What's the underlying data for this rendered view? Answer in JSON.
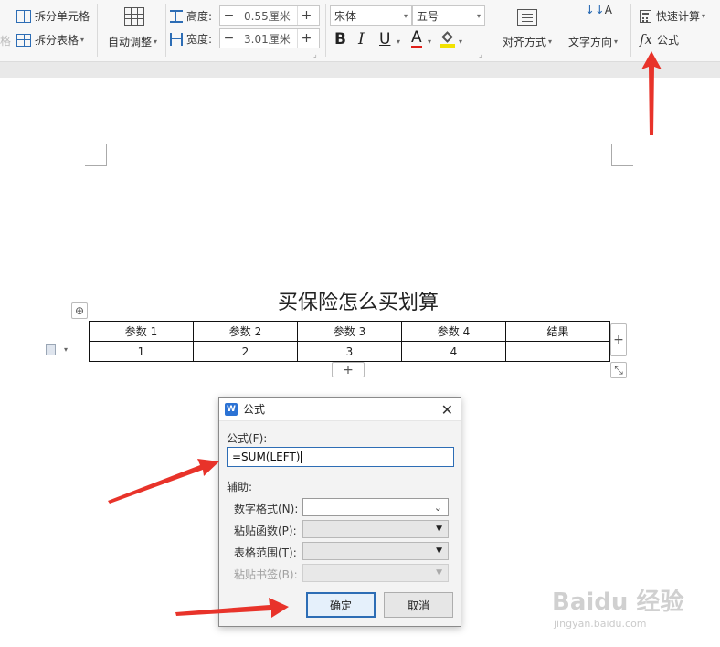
{
  "ribbon": {
    "split_cell": "拆分单元格",
    "split_table": "拆分表格",
    "auto_adjust": "自动调整",
    "height_label": "高度:",
    "height_value": "0.55厘米",
    "width_label": "宽度:",
    "width_value": "3.01厘米",
    "font_name": "宋体",
    "font_size": "五号",
    "align": "对齐方式",
    "text_direction": "文字方向",
    "quick_calc": "快速计算",
    "formula": "公式",
    "fx_glyph": "fx",
    "bold": "B",
    "italic": "I",
    "underline": "U",
    "font_color": "A",
    "minus": "−",
    "plus": "+",
    "left_fragment": "格"
  },
  "document": {
    "title": "买保险怎么买划算",
    "table": {
      "headers": [
        "参数 1",
        "参数 2",
        "参数 3",
        "参数 4",
        "结果"
      ],
      "row": [
        "1",
        "2",
        "3",
        "4",
        ""
      ]
    },
    "add_row": "+",
    "add_col": "+",
    "move_handle": "⊕"
  },
  "dialog": {
    "logo": "W",
    "title": "公式",
    "close": "✕",
    "formula_label": "公式(F):",
    "formula_value": "=SUM(LEFT)",
    "assist_label": "辅助:",
    "number_format_label": "数字格式(N):",
    "paste_function_label": "粘贴函数(P):",
    "table_range_label": "表格范围(T):",
    "paste_bookmark_label": "粘贴书签(B):",
    "ok": "确定",
    "cancel": "取消"
  },
  "watermark": {
    "brand": "Baidu 经验",
    "url": "jingyan.baidu.com"
  },
  "colors": {
    "accent": "#2d6db5",
    "arrow": "#e8332a"
  }
}
